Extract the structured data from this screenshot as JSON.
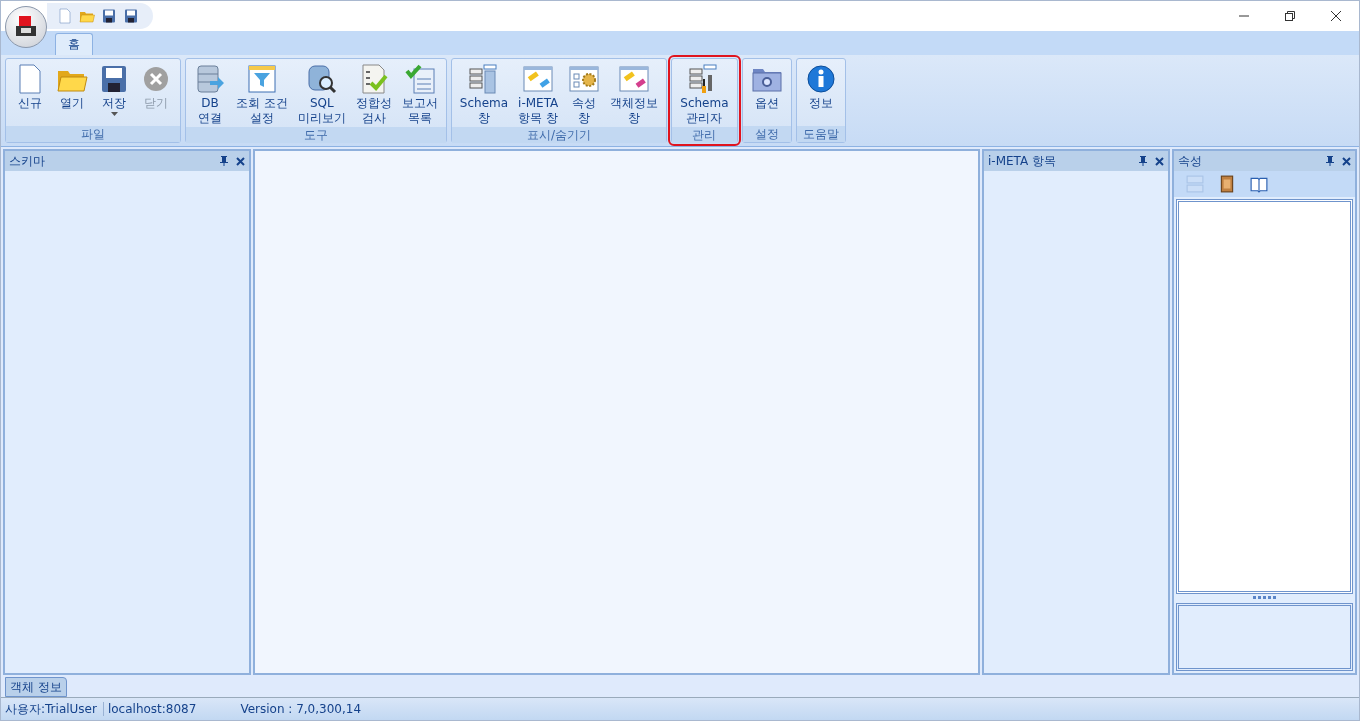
{
  "quick_access": [
    {
      "kind": "new"
    },
    {
      "kind": "open"
    },
    {
      "kind": "save"
    },
    {
      "kind": "saveas"
    }
  ],
  "tabs": [
    {
      "label": "홈",
      "selected": true
    }
  ],
  "ribbon": [
    {
      "label": "파일",
      "highlighted": false,
      "buttons": [
        {
          "kind": "new",
          "lines": [
            "신규"
          ],
          "disabled": false,
          "dropdown": false
        },
        {
          "kind": "open",
          "lines": [
            "열기"
          ],
          "disabled": false,
          "dropdown": false
        },
        {
          "kind": "save",
          "lines": [
            "저장"
          ],
          "disabled": false,
          "dropdown": true
        },
        {
          "kind": "close",
          "lines": [
            "닫기"
          ],
          "disabled": true,
          "dropdown": false
        }
      ]
    },
    {
      "label": "도구",
      "highlighted": false,
      "buttons": [
        {
          "kind": "db",
          "lines": [
            "DB",
            "연결"
          ],
          "disabled": false,
          "dropdown": false
        },
        {
          "kind": "filter",
          "lines": [
            "조회 조건",
            "설정"
          ],
          "disabled": false,
          "dropdown": false
        },
        {
          "kind": "dbsearch",
          "lines": [
            "SQL",
            "미리보기"
          ],
          "disabled": false,
          "dropdown": false
        },
        {
          "kind": "check",
          "lines": [
            "정합성",
            "검사"
          ],
          "disabled": false,
          "dropdown": false
        },
        {
          "kind": "report",
          "lines": [
            "보고서",
            "목록"
          ],
          "disabled": false,
          "dropdown": false
        }
      ]
    },
    {
      "label": "표시/숨기기",
      "highlighted": false,
      "buttons": [
        {
          "kind": "schema",
          "lines": [
            "Schema",
            "창"
          ],
          "disabled": false,
          "dropdown": false
        },
        {
          "kind": "meta",
          "lines": [
            "i-META",
            "항목 창"
          ],
          "disabled": false,
          "dropdown": false
        },
        {
          "kind": "props",
          "lines": [
            "속성",
            "창"
          ],
          "disabled": false,
          "dropdown": false
        },
        {
          "kind": "objinfo",
          "lines": [
            "객체정보",
            "창"
          ],
          "disabled": false,
          "dropdown": false
        }
      ]
    },
    {
      "label": "관리",
      "highlighted": true,
      "buttons": [
        {
          "kind": "schematool",
          "lines": [
            "Schema",
            "관리자"
          ],
          "disabled": false,
          "dropdown": false
        }
      ]
    },
    {
      "label": "설정",
      "highlighted": false,
      "buttons": [
        {
          "kind": "options",
          "lines": [
            "옵션"
          ],
          "disabled": false,
          "dropdown": false
        }
      ]
    },
    {
      "label": "도움말",
      "highlighted": false,
      "buttons": [
        {
          "kind": "info",
          "lines": [
            "정보"
          ],
          "disabled": false,
          "dropdown": false
        }
      ]
    }
  ],
  "panels": {
    "schema": {
      "title": "스키마"
    },
    "imeta": {
      "title": "i-META 항목"
    },
    "properties": {
      "title": "속성",
      "toolbar": [
        {
          "kind": "grid",
          "disabled": true
        },
        {
          "kind": "book",
          "disabled": false
        },
        {
          "kind": "openbook",
          "disabled": false
        }
      ]
    }
  },
  "bottom_tabs": [
    {
      "label": "객체 정보",
      "selected": true
    }
  ],
  "status_bar": [
    "사용자:TrialUser",
    "localhost:8087",
    "Version : 7,0,300,14"
  ]
}
